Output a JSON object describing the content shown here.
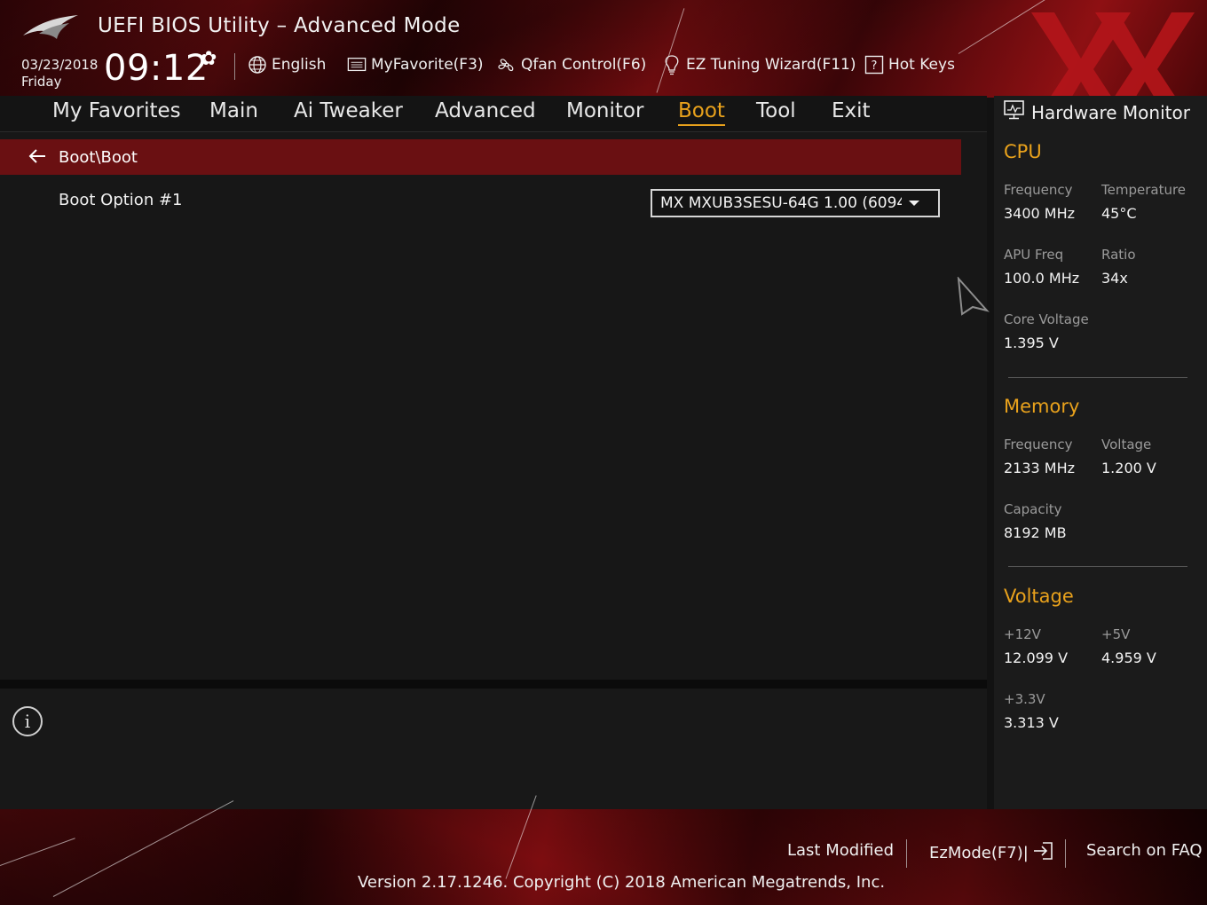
{
  "header": {
    "title": "UEFI BIOS Utility – Advanced Mode",
    "date": "03/23/2018",
    "day": "Friday",
    "time": "09:12",
    "tools": [
      {
        "icon": "globe-icon",
        "label": "English"
      },
      {
        "icon": "favorites-list-icon",
        "label": "MyFavorite(F3)"
      },
      {
        "icon": "fan-icon",
        "label": "Qfan Control(F6)"
      },
      {
        "icon": "lightbulb-icon",
        "label": "EZ Tuning Wizard(F11)"
      },
      {
        "icon": "question-box-icon",
        "label": "Hot Keys"
      }
    ]
  },
  "nav": {
    "tabs": [
      "My Favorites",
      "Main",
      "Ai Tweaker",
      "Advanced",
      "Monitor",
      "Boot",
      "Tool",
      "Exit"
    ],
    "active": "Boot"
  },
  "main": {
    "breadcrumb": "Boot\\Boot",
    "boot_option_label": "Boot Option #1",
    "boot_option_value": "MX MXUB3SESU-64G 1.00  (6094"
  },
  "hardware_monitor": {
    "title": "Hardware Monitor",
    "cpu": {
      "heading": "CPU",
      "frequency_label": "Frequency",
      "frequency": "3400 MHz",
      "temperature_label": "Temperature",
      "temperature": "45°C",
      "apu_label": "APU Freq",
      "apu": "100.0 MHz",
      "ratio_label": "Ratio",
      "ratio": "34x",
      "core_voltage_label": "Core Voltage",
      "core_voltage": "1.395 V"
    },
    "memory": {
      "heading": "Memory",
      "frequency_label": "Frequency",
      "frequency": "2133 MHz",
      "voltage_label": "Voltage",
      "voltage": "1.200 V",
      "capacity_label": "Capacity",
      "capacity": "8192 MB"
    },
    "voltage": {
      "heading": "Voltage",
      "v12_label": "+12V",
      "v12": "12.099 V",
      "v5_label": "+5V",
      "v5": "4.959 V",
      "v33_label": "+3.3V",
      "v33": "3.313 V"
    }
  },
  "footer": {
    "last_modified": "Last Modified",
    "ezmode": "EzMode(F7)|",
    "search_faq": "Search on FAQ",
    "version": "Version 2.17.1246. Copyright (C) 2018 American Megatrends, Inc."
  },
  "colors": {
    "accent": "#e9a21c",
    "breadcrumb_bg": "#6a1012",
    "brand_red": "#b3151a"
  }
}
